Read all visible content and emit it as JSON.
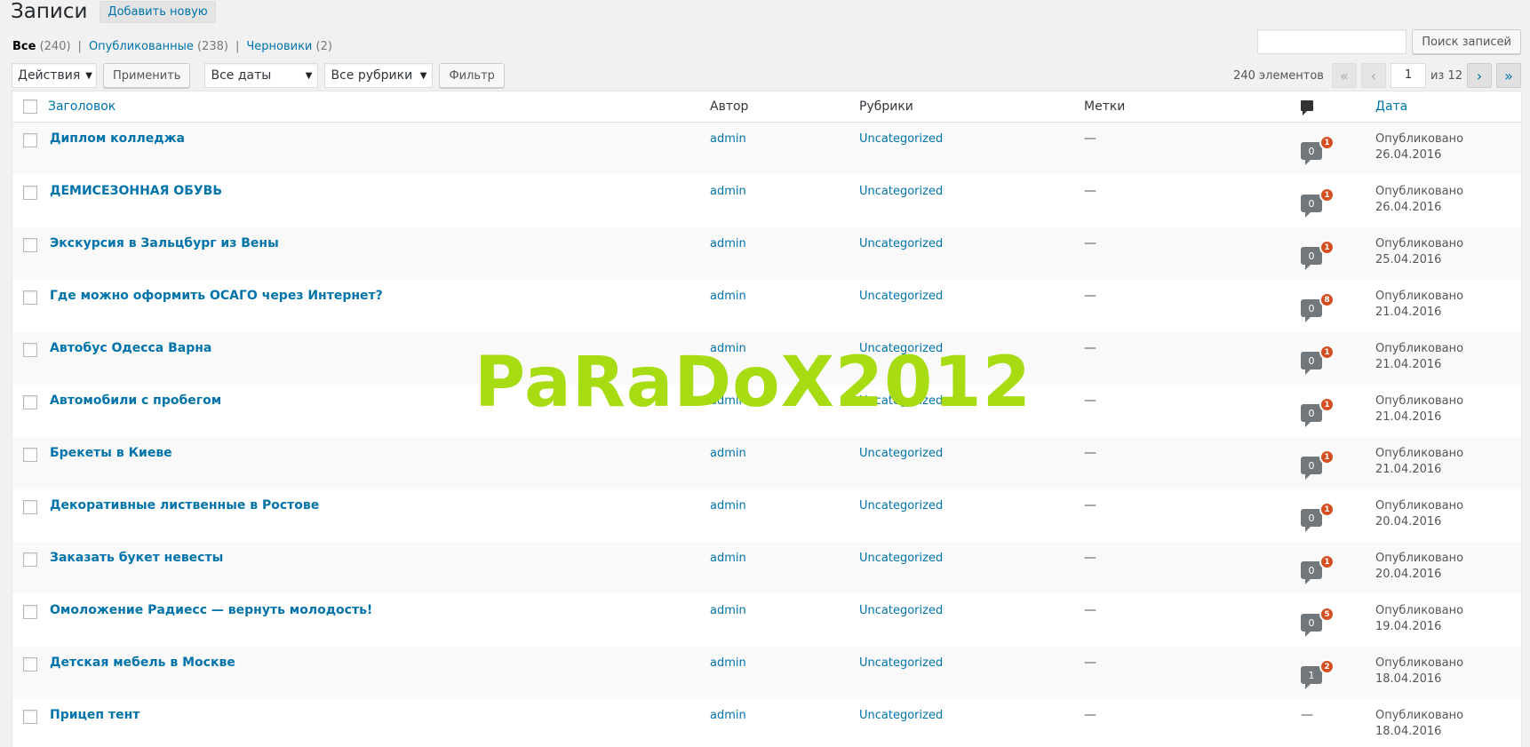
{
  "header": {
    "title": "Записи",
    "add_new": "Добавить новую"
  },
  "filters": {
    "all_label": "Все",
    "all_count": "(240)",
    "published_label": "Опубликованные",
    "published_count": "(238)",
    "drafts_label": "Черновики",
    "drafts_count": "(2)",
    "separator": "|"
  },
  "search": {
    "value": "",
    "button": "Поиск записей"
  },
  "tablenav": {
    "bulk_actions": "Действия",
    "apply": "Применить",
    "dates": "Все даты",
    "categories": "Все рубрики",
    "filter": "Фильтр",
    "items_count": "240 элементов",
    "first": "«",
    "prev": "‹",
    "current_page": "1",
    "of_total": "из 12",
    "next": "›",
    "last": "»"
  },
  "columns": {
    "title": "Заголовок",
    "author": "Автор",
    "categories": "Рубрики",
    "tags": "Метки",
    "date": "Дата"
  },
  "posts": [
    {
      "title": "Диплом колледжа",
      "author": "admin",
      "category": "Uncategorized",
      "tags": "—",
      "comments": "0",
      "pending": "1",
      "status": "Опубликовано",
      "date": "26.04.2016"
    },
    {
      "title": "ДЕМИСЕЗОННАЯ ОБУВЬ",
      "author": "admin",
      "category": "Uncategorized",
      "tags": "—",
      "comments": "0",
      "pending": "1",
      "status": "Опубликовано",
      "date": "26.04.2016"
    },
    {
      "title": "Экскурсия в Зальцбург из Вены",
      "author": "admin",
      "category": "Uncategorized",
      "tags": "—",
      "comments": "0",
      "pending": "1",
      "status": "Опубликовано",
      "date": "25.04.2016"
    },
    {
      "title": "Где можно оформить ОСАГО через Интернет?",
      "author": "admin",
      "category": "Uncategorized",
      "tags": "—",
      "comments": "0",
      "pending": "8",
      "status": "Опубликовано",
      "date": "21.04.2016"
    },
    {
      "title": "Автобус Одесса Варна",
      "author": "admin",
      "category": "Uncategorized",
      "tags": "—",
      "comments": "0",
      "pending": "1",
      "status": "Опубликовано",
      "date": "21.04.2016"
    },
    {
      "title": "Автомобили с пробегом",
      "author": "admin",
      "category": "Uncategorized",
      "tags": "—",
      "comments": "0",
      "pending": "1",
      "status": "Опубликовано",
      "date": "21.04.2016"
    },
    {
      "title": "Брекеты в Киеве",
      "author": "admin",
      "category": "Uncategorized",
      "tags": "—",
      "comments": "0",
      "pending": "1",
      "status": "Опубликовано",
      "date": "21.04.2016"
    },
    {
      "title": "Декоративные лиственные в Ростове",
      "author": "admin",
      "category": "Uncategorized",
      "tags": "—",
      "comments": "0",
      "pending": "1",
      "status": "Опубликовано",
      "date": "20.04.2016"
    },
    {
      "title": "Заказать букет невесты",
      "author": "admin",
      "category": "Uncategorized",
      "tags": "—",
      "comments": "0",
      "pending": "1",
      "status": "Опубликовано",
      "date": "20.04.2016"
    },
    {
      "title": "Омоложение Радиесс — вернуть молодость!",
      "author": "admin",
      "category": "Uncategorized",
      "tags": "—",
      "comments": "0",
      "pending": "5",
      "status": "Опубликовано",
      "date": "19.04.2016"
    },
    {
      "title": "Детская мебель в Москве",
      "author": "admin",
      "category": "Uncategorized",
      "tags": "—",
      "comments": "1",
      "pending": "2",
      "status": "Опубликовано",
      "date": "18.04.2016"
    },
    {
      "title": "Прицеп тент",
      "author": "admin",
      "category": "Uncategorized",
      "tags": "—",
      "comments": "—",
      "pending": "",
      "status": "Опубликовано",
      "date": "18.04.2016"
    }
  ],
  "watermark": "PaRaDoX2012",
  "colors": {
    "link": "#0073aa",
    "pending_badge": "#d54e21",
    "watermark": "#a7db12"
  }
}
